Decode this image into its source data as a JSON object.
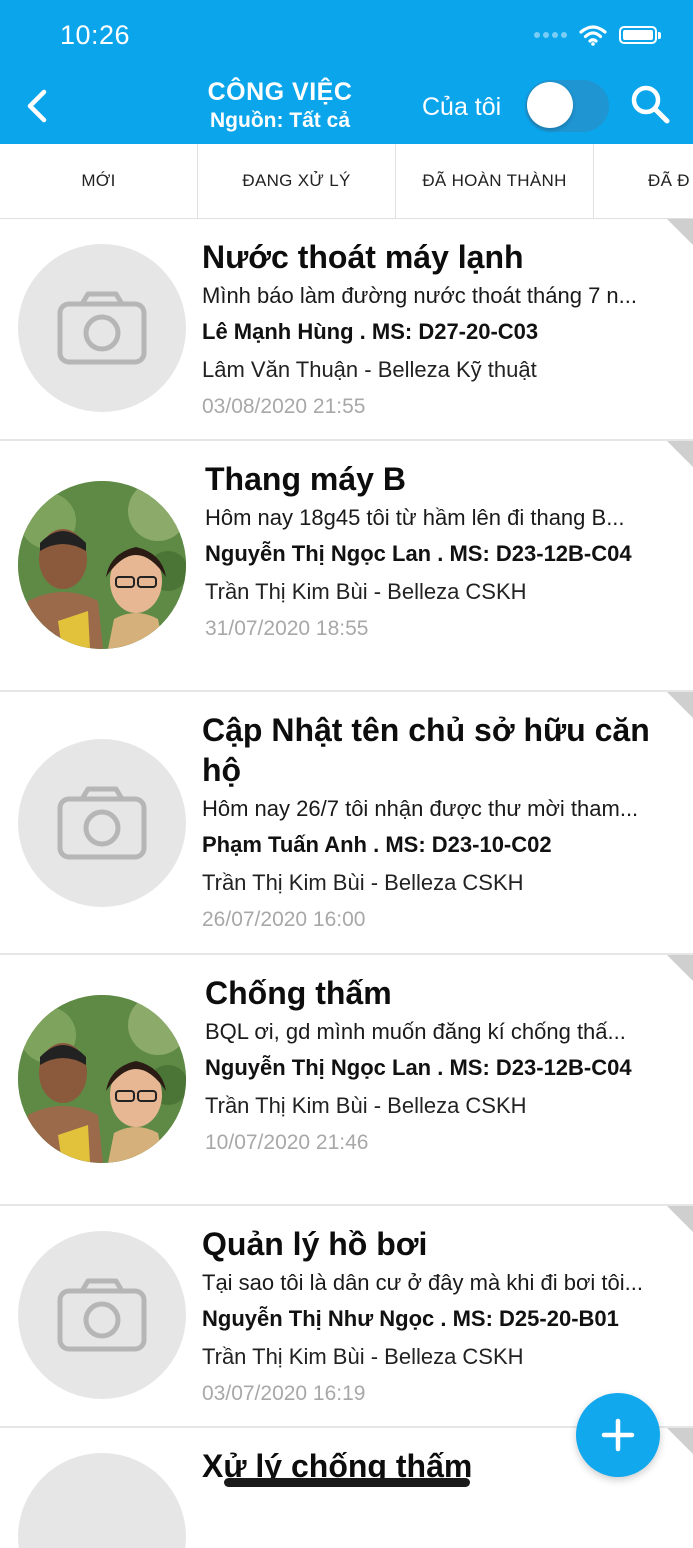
{
  "status_bar": {
    "time": "10:26"
  },
  "header": {
    "title": "CÔNG VIỆC",
    "subtitle": "Nguồn: Tất cả",
    "mine_label": "Của tôi",
    "mine_toggle_on": false,
    "accent_color": "#0ba5ec"
  },
  "tabs": [
    {
      "label": "MỚI"
    },
    {
      "label": "ĐANG XỬ LÝ"
    },
    {
      "label": "ĐÃ HOÀN THÀNH"
    },
    {
      "label": "ĐÃ Đ"
    }
  ],
  "tasks": [
    {
      "title": "Nước thoát máy lạnh",
      "desc": "Mình báo làm đường nước thoát tháng 7 n...",
      "owner": " Lê Mạnh Hùng . MS: D27-20-C03",
      "staff": "Lâm Văn Thuận - Belleza Kỹ thuật",
      "date": "03/08/2020 21:55",
      "image": "camera-placeholder"
    },
    {
      "title": "Thang máy B",
      "desc": "Hôm nay 18g45 tôi từ hầm lên đi thang B...",
      "owner": " Nguyễn Thị Ngọc Lan . MS: D23-12B-C04",
      "staff": "Trần Thị Kim Bùi - Belleza CSKH",
      "date": "31/07/2020 18:55",
      "image": "user-photo"
    },
    {
      "title": "Cập Nhật tên chủ sở hữu căn hộ",
      "desc": "Hôm nay 26/7 tôi nhận được thư mời tham...",
      "owner": "Phạm Tuấn Anh . MS: D23-10-C02",
      "staff": "Trần Thị Kim Bùi - Belleza CSKH",
      "date": "26/07/2020 16:00",
      "image": "camera-placeholder"
    },
    {
      "title": "Chống thấm",
      "desc": "BQL ơi, gd mình muốn đăng kí chống thấ...",
      "owner": " Nguyễn Thị Ngọc Lan . MS: D23-12B-C04",
      "staff": "Trần Thị Kim Bùi - Belleza CSKH",
      "date": "10/07/2020 21:46",
      "image": "user-photo"
    },
    {
      "title": "Quản lý hồ bơi",
      "desc": "Tại sao tôi là dân cư ở đây mà khi đi bơi tôi...",
      "owner": " Nguyễn Thị Như Ngọc . MS: D25-20-B01",
      "staff": "Trần Thị Kim Bùi - Belleza CSKH",
      "date": "03/07/2020 16:19",
      "image": "camera-placeholder"
    },
    {
      "title": "Xử lý chống thấm",
      "desc": "",
      "owner": "",
      "staff": "",
      "date": "",
      "image": "camera-placeholder"
    }
  ]
}
